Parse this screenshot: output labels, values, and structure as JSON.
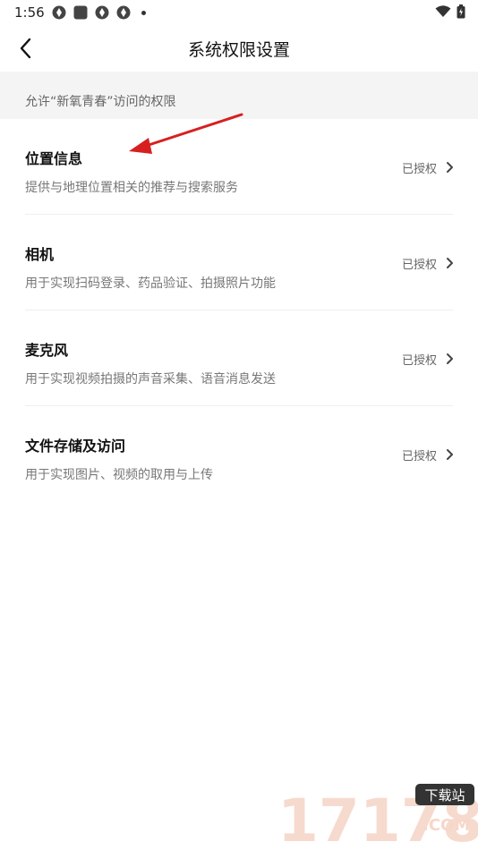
{
  "status_bar": {
    "time": "1:56"
  },
  "header": {
    "title": "系统权限设置"
  },
  "section": {
    "label": "允许“新氧青春”访问的权限"
  },
  "permissions": [
    {
      "title": "位置信息",
      "description": "提供与地理位置相关的推荐与搜索服务",
      "status": "已授权"
    },
    {
      "title": "相机",
      "description": "用于实现扫码登录、药品验证、拍摄照片功能",
      "status": "已授权"
    },
    {
      "title": "麦克风",
      "description": "用于实现视频拍摄的声音采集、语音消息发送",
      "status": "已授权"
    },
    {
      "title": "文件存储及访问",
      "description": "用于实现图片、视频的取用与上传",
      "status": "已授权"
    }
  ],
  "watermark": {
    "text": "17178",
    "badge": "下载站",
    "suffix": ".COM"
  },
  "colors": {
    "annotation_arrow": "#d62020",
    "section_bg": "#f4f4f4"
  }
}
